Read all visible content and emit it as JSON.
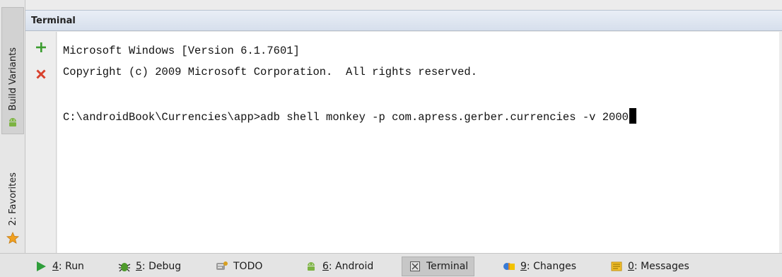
{
  "left_toolbar": {
    "build_variants": {
      "label": "Build Variants",
      "icon": "android-icon"
    },
    "favorites": {
      "label": "2: Favorites",
      "icon": "star-icon"
    }
  },
  "terminal": {
    "title": "Terminal",
    "actions": {
      "add": "plus-icon",
      "close": "close-icon"
    },
    "lines": [
      "Microsoft Windows [Version 6.1.7601]",
      "Copyright (c) 2009 Microsoft Corporation.  All rights reserved.",
      "",
      "C:\\androidBook\\Currencies\\app>adb shell monkey -p com.apress.gerber.currencies -v 2000"
    ]
  },
  "bottom_tabs": [
    {
      "mnemonic": "4",
      "label": ": Run",
      "icon": "run-icon"
    },
    {
      "mnemonic": "5",
      "label": ": Debug",
      "icon": "debug-icon"
    },
    {
      "mnemonic": "",
      "label": "TODO",
      "icon": "todo-icon"
    },
    {
      "mnemonic": "6",
      "label": ": Android",
      "icon": "android-icon"
    },
    {
      "mnemonic": "",
      "label": "Terminal",
      "icon": "terminal-icon",
      "active": true
    },
    {
      "mnemonic": "9",
      "label": ": Changes",
      "icon": "changes-icon"
    },
    {
      "mnemonic": "0",
      "label": ": Messages",
      "icon": "messages-icon"
    }
  ],
  "colors": {
    "accent_green": "#3a9c2e",
    "close_red": "#d8402c",
    "header_blue": "#d6dfec",
    "favorite_star": "#f0a020"
  }
}
